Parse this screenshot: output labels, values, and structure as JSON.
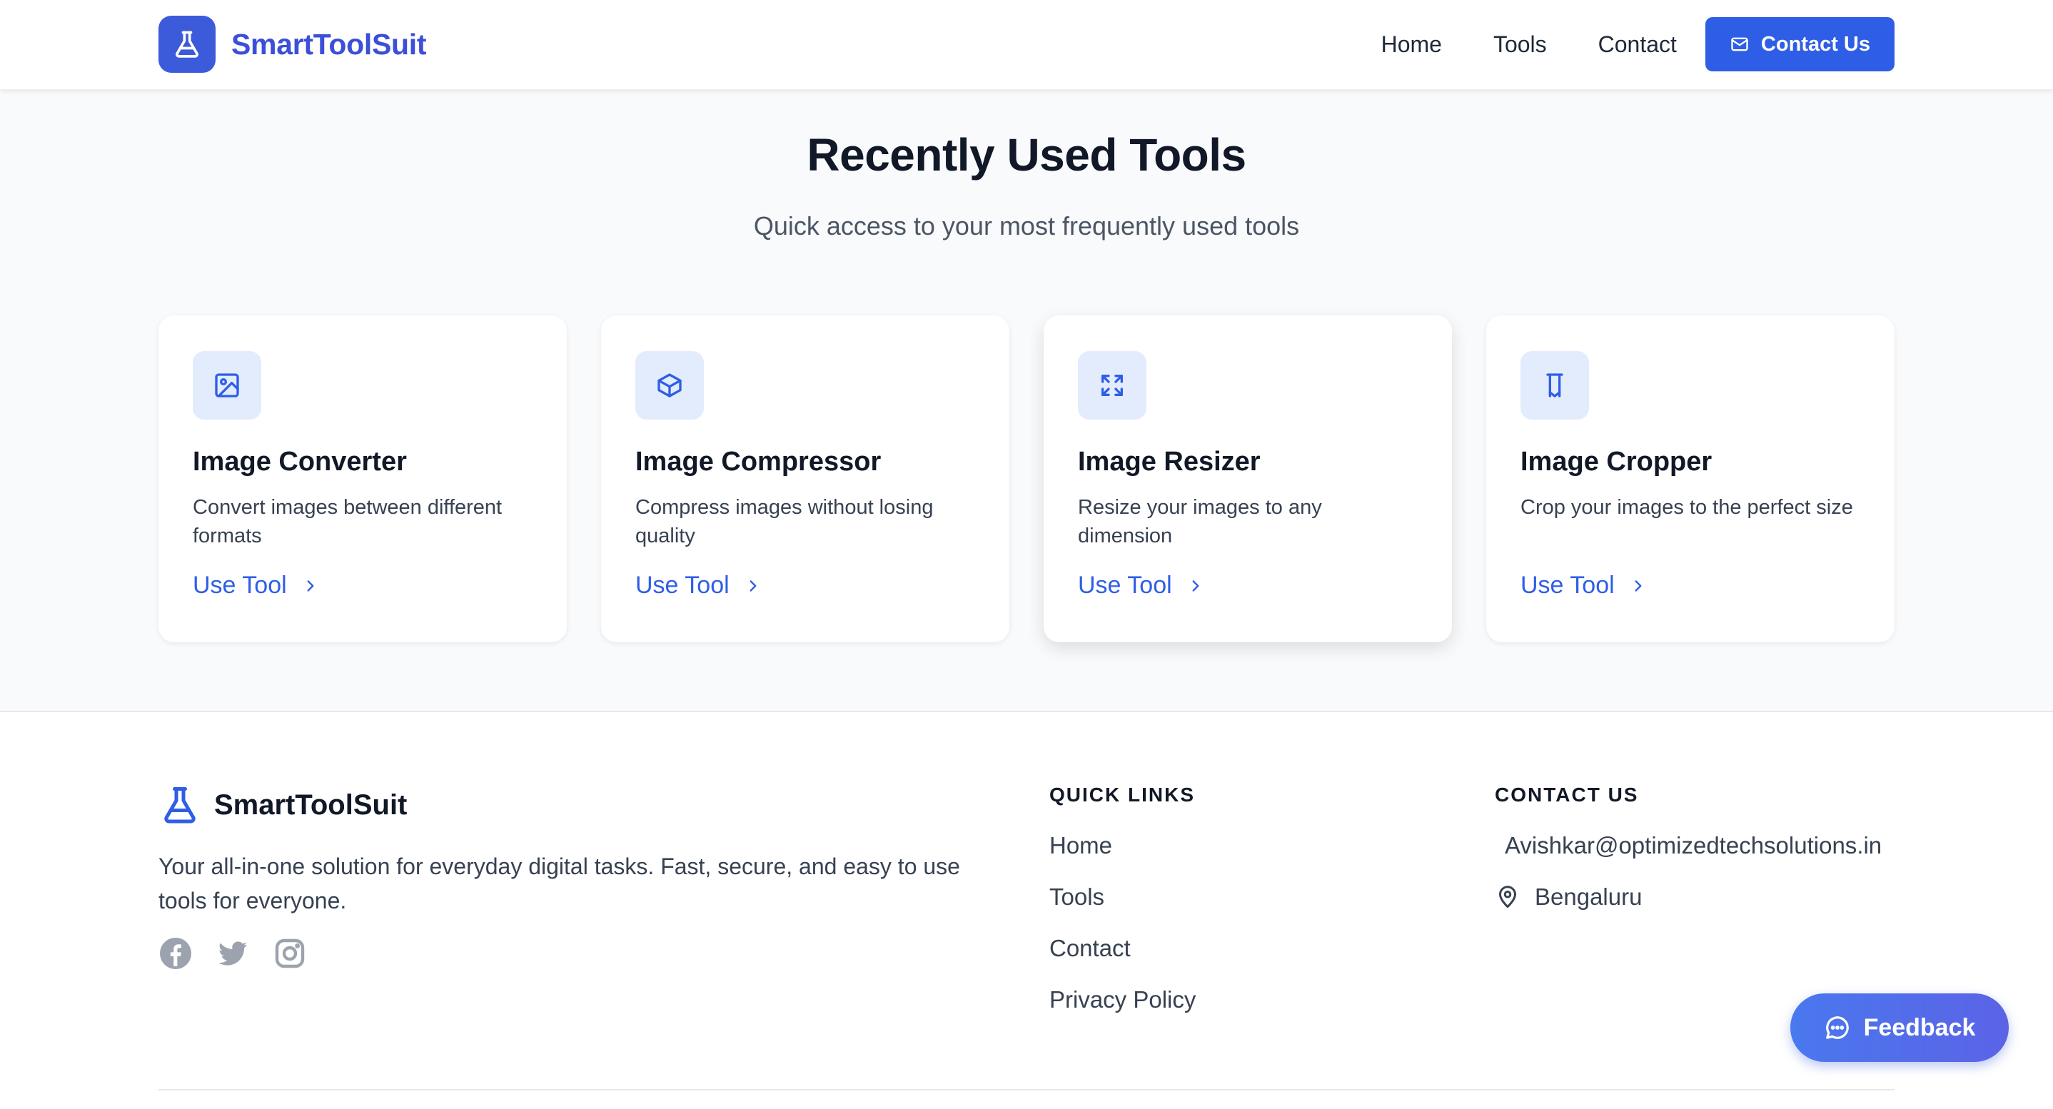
{
  "header": {
    "brand": "SmartToolSuit",
    "nav": [
      "Home",
      "Tools",
      "Contact"
    ],
    "contact_button": "Contact Us",
    "icons": {
      "logo": "flask-icon",
      "contact": "mail-icon"
    },
    "accent_color": "#2f5ee6"
  },
  "hero": {
    "title": "Recently Used Tools",
    "subtitle": "Quick access to your most frequently used tools"
  },
  "tools": [
    {
      "title": "Image Converter",
      "description": "Convert images between different formats",
      "link": "Use Tool",
      "icon": "image-icon"
    },
    {
      "title": "Image Compressor",
      "description": "Compress images without losing quality",
      "link": "Use Tool",
      "icon": "box-icon"
    },
    {
      "title": "Image Resizer",
      "description": "Resize your images to any dimension",
      "link": "Use Tool",
      "icon": "expand-icon"
    },
    {
      "title": "Image Cropper",
      "description": "Crop your images to the perfect size",
      "link": "Use Tool",
      "icon": "crop-icon"
    }
  ],
  "footer": {
    "brand": "SmartToolSuit",
    "description": "Your all-in-one solution for everyday digital tasks. Fast, secure, and easy to use tools for everyone.",
    "socials": [
      "facebook-icon",
      "twitter-icon",
      "instagram-icon"
    ],
    "quick_links_title": "QUICK LINKS",
    "quick_links": [
      "Home",
      "Tools",
      "Contact",
      "Privacy Policy"
    ],
    "contact_title": "CONTACT US",
    "email": "Avishkar@optimizedtechsolutions.in",
    "location": "Bengaluru"
  },
  "feedback_button": "Feedback"
}
